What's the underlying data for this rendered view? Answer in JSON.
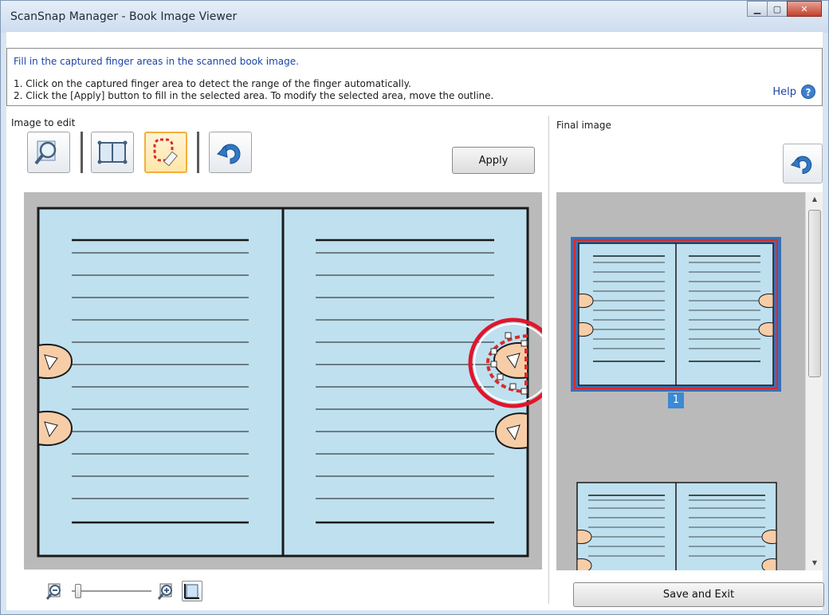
{
  "window": {
    "title": "ScanSnap Manager - Book Image Viewer",
    "controls": [
      "minimize",
      "maximize",
      "close"
    ]
  },
  "instructions": {
    "title": "Fill in the captured finger areas in the scanned book image.",
    "line1": "1. Click on the captured finger area to detect the range of the finger automatically.",
    "line2": "2. Click the [Apply] button to fill in the selected area. To modify the selected area, move the outline.",
    "help_label": "Help",
    "help_icon": "question-icon"
  },
  "edit_panel": {
    "label": "Image to edit",
    "tools": [
      {
        "name": "magnifier-tool",
        "icon": "magnifier-icon",
        "active": false
      },
      {
        "name": "page-crop-tool",
        "icon": "book-crop-icon",
        "active": false
      },
      {
        "name": "finger-fill-tool",
        "icon": "finger-eraser-icon",
        "active": true
      },
      {
        "name": "undo-tool",
        "icon": "undo-icon",
        "active": false
      }
    ],
    "apply_label": "Apply"
  },
  "final_panel": {
    "label": "Final image",
    "undo_icon": "undo-icon",
    "page_number": "1"
  },
  "bottom": {
    "zoom_out_icon": "zoom-out-icon",
    "zoom_in_icon": "zoom-in-icon",
    "fit_icon": "fit-page-icon",
    "save_label": "Save and Exit"
  },
  "colors": {
    "page_fill": "#bfe0ef",
    "canvas_bg": "#bababa",
    "highlight_red": "#e0162b",
    "link_blue": "#1c44a6",
    "selected_frame": "#3a6fb8"
  }
}
